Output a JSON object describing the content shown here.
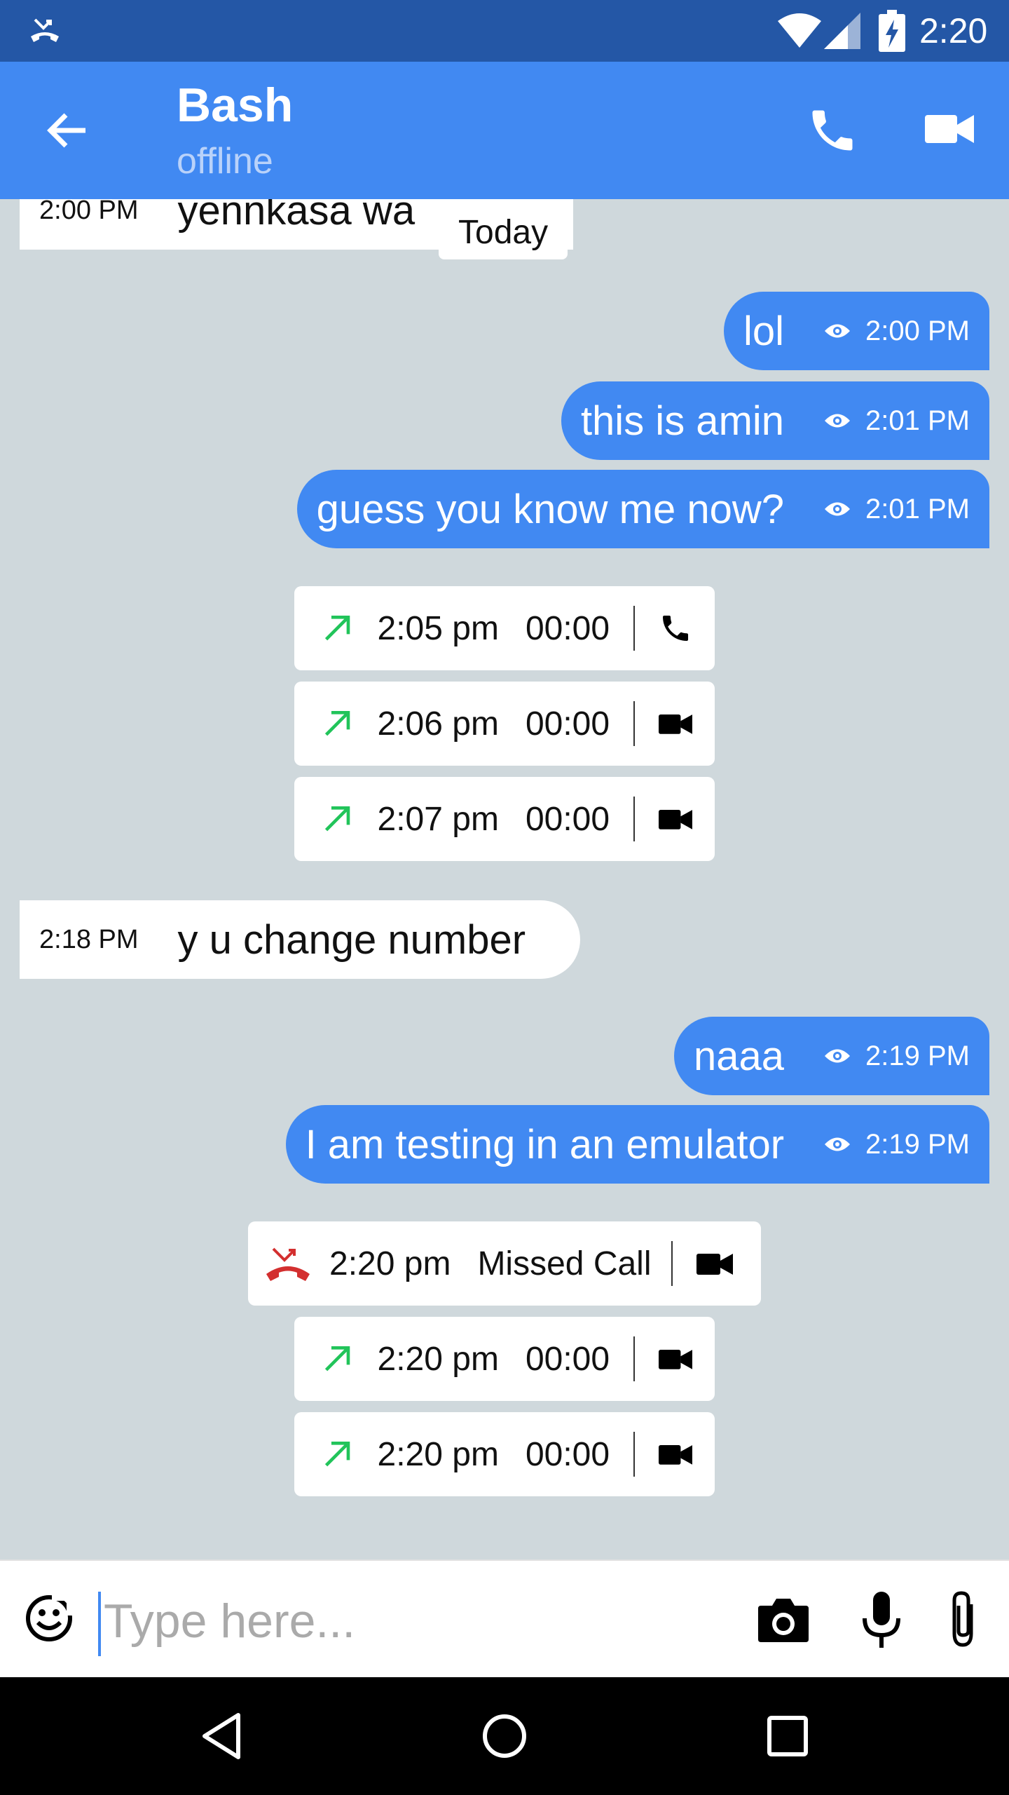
{
  "status_bar": {
    "time": "2:20",
    "left_icon": "missed-call-notification-icon",
    "icons": [
      "wifi-icon",
      "signal-icon",
      "battery-charging-icon"
    ]
  },
  "header": {
    "contact_name": "Bash",
    "status": "offline",
    "actions": [
      "phone-icon",
      "video-camera-icon"
    ],
    "back_icon": "arrow-back-icon"
  },
  "today_label": "Today",
  "incoming": [
    {
      "time": "2:00 PM",
      "text": "yennkasa wa"
    },
    {
      "time": "2:18 PM",
      "text": "y u change number"
    }
  ],
  "outgoing": [
    {
      "text": "lol",
      "time": "2:00 PM"
    },
    {
      "text": "this is  amin",
      "time": "2:01 PM"
    },
    {
      "text": "guess you know me now?",
      "time": "2:01 PM"
    },
    {
      "text": "naaa",
      "time": "2:19 PM"
    },
    {
      "text": "I am testing in an emulator",
      "time": "2:19 PM"
    }
  ],
  "calls": [
    {
      "time": "2:05 pm",
      "status": "00:00",
      "kind": "voice",
      "direction": "outgoing"
    },
    {
      "time": "2:06 pm",
      "status": "00:00",
      "kind": "video",
      "direction": "outgoing"
    },
    {
      "time": "2:07 pm",
      "status": "00:00",
      "kind": "video",
      "direction": "outgoing"
    },
    {
      "time": "2:20 pm",
      "status": "Missed Call",
      "kind": "video",
      "direction": "missed"
    },
    {
      "time": "2:20 pm",
      "status": "00:00",
      "kind": "video",
      "direction": "outgoing"
    },
    {
      "time": "2:20 pm",
      "status": "00:00",
      "kind": "video",
      "direction": "outgoing"
    }
  ],
  "composer": {
    "placeholder": "Type here...",
    "value": "",
    "icons": [
      "emoji-icon",
      "camera-icon",
      "microphone-icon",
      "attach-icon"
    ]
  },
  "nav": [
    "back-triangle-icon",
    "home-circle-icon",
    "recents-square-icon"
  ],
  "colors": {
    "status_bar": "#2457a6",
    "app_bar": "#4189f2",
    "chat_background": "#cfd8dc",
    "outgoing_bubble": "#4189f2",
    "incoming_bubble": "#ffffff",
    "call_arrow": "#21c45a",
    "missed_call": "#d32f2f"
  }
}
